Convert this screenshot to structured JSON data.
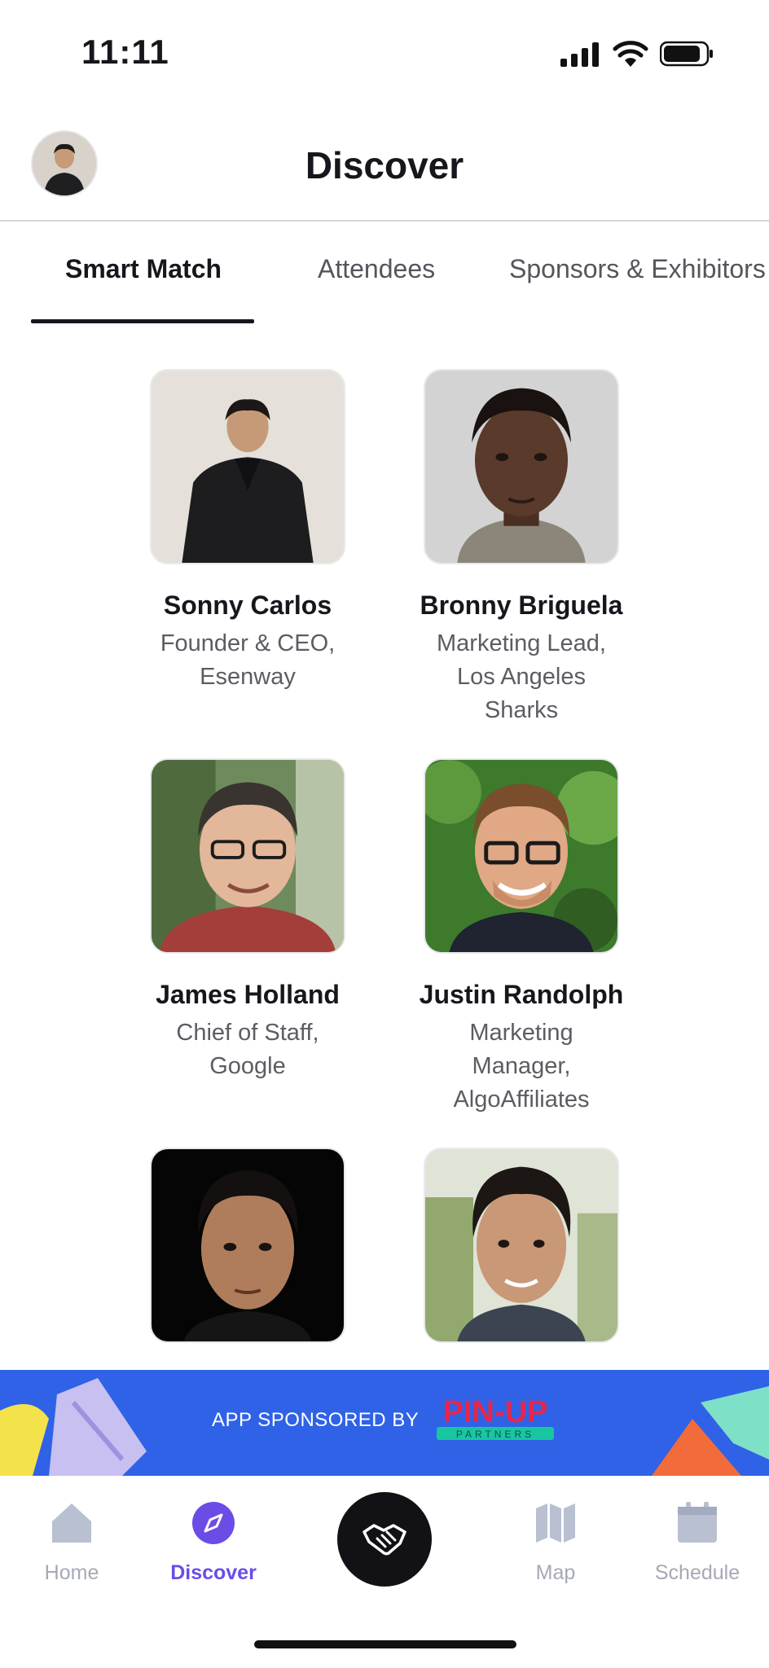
{
  "status_bar": {
    "time": "11:11"
  },
  "header": {
    "title": "Discover"
  },
  "tabs": [
    {
      "label": "Smart Match",
      "active": true
    },
    {
      "label": "Attendees",
      "active": false
    },
    {
      "label": "Sponsors & Exhibitors",
      "active": false
    }
  ],
  "people": [
    {
      "name": "Sonny Carlos",
      "title": "Founder & CEO, Esenway"
    },
    {
      "name": "Bronny Briguela",
      "title": "Marketing Lead, Los Angeles Sharks"
    },
    {
      "name": "James Holland",
      "title": "Chief of Staff, Google"
    },
    {
      "name": "Justin Randolph",
      "title": "Marketing Manager, AlgoAffiliates"
    },
    {
      "name": "",
      "title": ""
    },
    {
      "name": "",
      "title": ""
    }
  ],
  "sponsor": {
    "text": "APP SPONSORED BY",
    "logo_text": "PIN-UP",
    "logo_subtext": "PARTNERS"
  },
  "nav": {
    "home": "Home",
    "discover": "Discover",
    "map": "Map",
    "schedule": "Schedule"
  },
  "colors": {
    "accent": "#6b4de6",
    "banner": "#2f62e6",
    "inactive_nav": "#a6a8b6"
  }
}
